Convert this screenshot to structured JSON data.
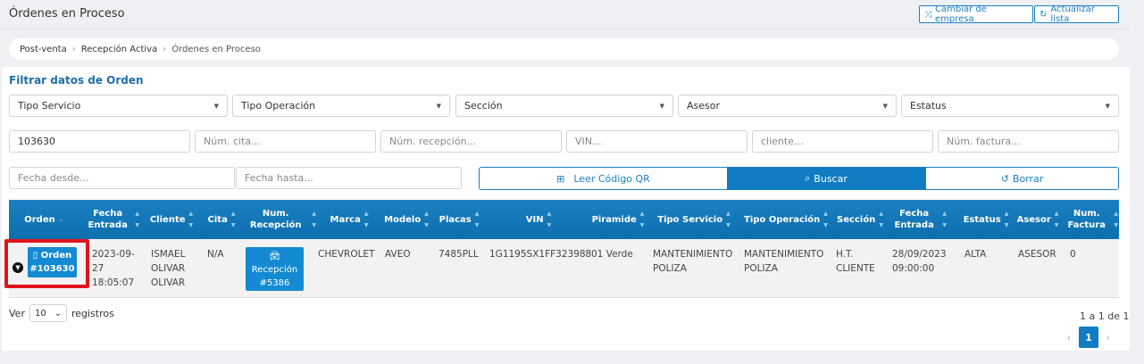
{
  "page": {
    "title": "Órdenes en Proceso"
  },
  "toolbar": {
    "change_company": "Cambiar de empresa",
    "refresh_list": "Actualizar lista"
  },
  "breadcrumb": [
    "Post-venta",
    "Recepción Activa",
    "Órdenes en Proceso"
  ],
  "filters": {
    "title": "Filtrar datos de Orden",
    "selects": [
      "Tipo Servicio",
      "Tipo Operación",
      "Sección",
      "Asesor",
      "Estatus"
    ],
    "order_value": "103630",
    "placeholders": {
      "cita": "Núm. cita...",
      "recepcion": "Núm. recepción...",
      "vin": "VIN...",
      "cliente": "cliente...",
      "factura": "Núm. factura...",
      "fecha_desde": "Fecha desde...",
      "fecha_hasta": "Fecha hasta..."
    },
    "qr_label": "Leer Código QR",
    "search_label": "Buscar",
    "clear_label": "Borrar"
  },
  "table": {
    "headers": [
      "Orden",
      "Fecha Entrada",
      "Cliente",
      "Cita",
      "Num. Recepción",
      "Marca",
      "Modelo",
      "Placas",
      "VIN",
      "Piramide",
      "Tipo Servicio",
      "Tipo Operación",
      "Sección",
      "Fecha Entrada",
      "Estatus",
      "Asesor",
      "Num. Factura"
    ],
    "row": {
      "orden_label": "Orden",
      "orden_num": "#103630",
      "fecha_entrada": "2023-09-27 18:05:07",
      "cliente": "ISMAEL OLIVAR OLIVAR",
      "cita": "N/A",
      "recepcion_label": "Recepción",
      "recepcion_num": "#5386",
      "marca": "CHEVROLET",
      "modelo": "AVEO",
      "placas": "7485PLL",
      "vin": "1G1195SX1FF323988",
      "piramide": "01 Verde",
      "tipo_servicio": "MANTENIMIENTO POLIZA",
      "tipo_operacion": "MANTENIMIENTO POLIZA",
      "seccion": "H.T. CLIENTE",
      "fecha_entrada2": "28/09/2023 09:00:00",
      "estatus": "ALTA",
      "asesor": "ASESOR",
      "factura": "0"
    }
  },
  "footer": {
    "ver": "Ver",
    "page_size": "10",
    "registros": "registros",
    "info": "1 a 1 de 1",
    "prev": "‹",
    "current_page": "1",
    "next": "›"
  },
  "colors": {
    "primary": "#0f7cc4",
    "highlight": "#e0151b"
  }
}
